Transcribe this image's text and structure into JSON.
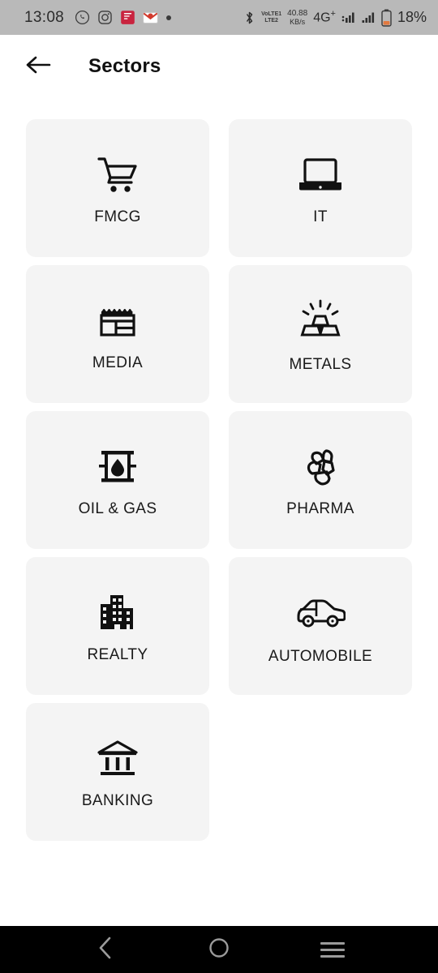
{
  "statusbar": {
    "time": "13:08",
    "app_icons": [
      "whatsapp-icon",
      "instagram-icon",
      "red-app-icon",
      "gmail-icon",
      "dot-icon"
    ],
    "volte_top": "VoLTE1",
    "volte_bottom": "LTE2",
    "net_speed_value": "40.88",
    "net_speed_unit": "KB/s",
    "network_type": "4G",
    "network_type_sup": "+",
    "battery": "18%",
    "bg_color": "#b9b9b9"
  },
  "header": {
    "back_icon": "arrow-left-icon",
    "title": "Sectors"
  },
  "sectors": [
    {
      "label": "FMCG",
      "icon": "shopping-cart-icon"
    },
    {
      "label": "IT",
      "icon": "laptop-icon"
    },
    {
      "label": "MEDIA",
      "icon": "newspaper-icon"
    },
    {
      "label": "METALS",
      "icon": "gold-bars-icon"
    },
    {
      "label": "OIL & GAS",
      "icon": "oil-barrel-icon"
    },
    {
      "label": "PHARMA",
      "icon": "pills-icon"
    },
    {
      "label": "REALTY",
      "icon": "buildings-icon"
    },
    {
      "label": "AUTOMOBILE",
      "icon": "car-icon"
    },
    {
      "label": "BANKING",
      "icon": "bank-icon"
    }
  ],
  "navbar": {
    "back": "nav-back-icon",
    "home": "nav-home-icon",
    "recents": "nav-recents-icon",
    "bg_color": "#000000"
  },
  "colors": {
    "page_bg": "#ffffff",
    "card_bg": "#f4f4f4",
    "text": "#1a1a1a"
  }
}
